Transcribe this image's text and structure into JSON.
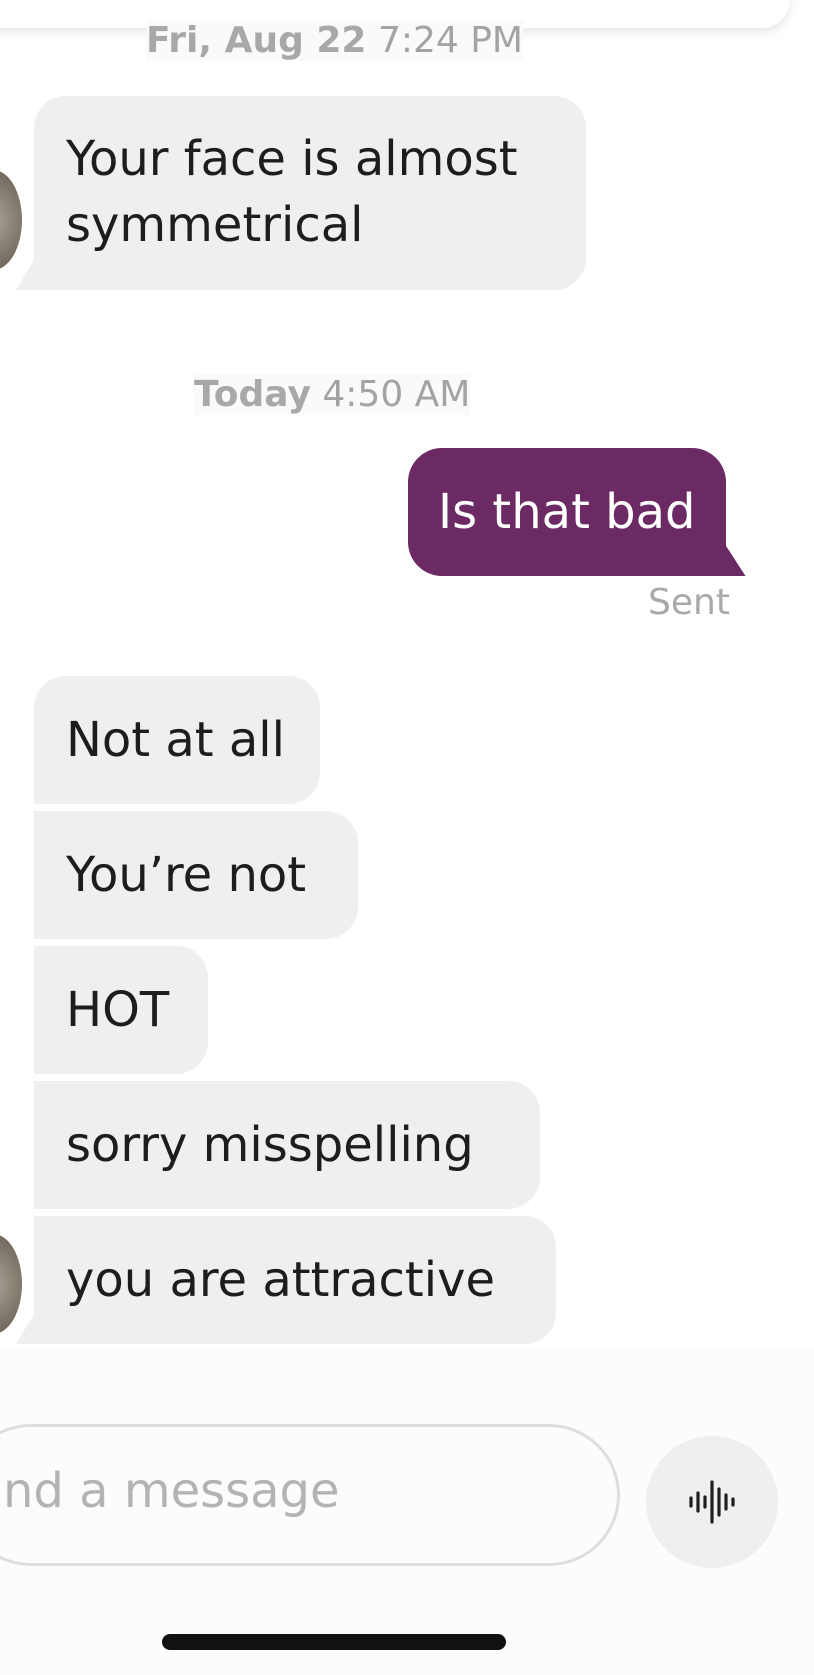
{
  "conversation": {
    "timestamp_1": {
      "day": "Fri, Aug 22",
      "time": "7:24 PM"
    },
    "incoming_1": {
      "line_1": "Your face is almost",
      "line_2": "symmetrical"
    },
    "timestamp_2": {
      "day": "Today",
      "time": "4:50 AM"
    },
    "outgoing_1": {
      "text": "Is that bad",
      "status": "Sent"
    },
    "incoming_group": [
      "Not at all",
      "You’re not",
      "HOT",
      "sorry misspelling",
      "you are attractive"
    ]
  },
  "composer": {
    "placeholder_visible": "nd a message"
  },
  "icons": {
    "voice": "audio-waveform-icon",
    "avatar": "avatar-image"
  },
  "colors": {
    "outgoing_bubble": "#6b2a63",
    "incoming_bubble": "#efefef",
    "timestamp_text": "#a3a3a3"
  }
}
